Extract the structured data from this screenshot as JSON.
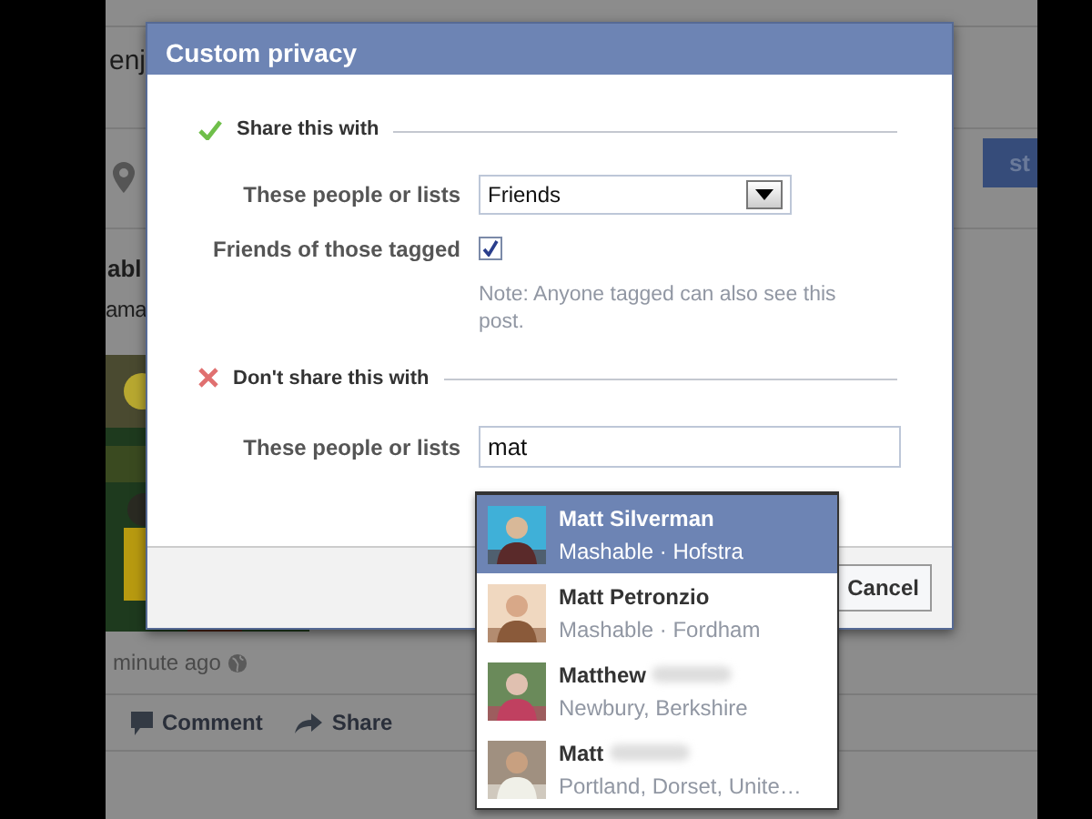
{
  "background_post": {
    "text_1": "enj",
    "button": "st",
    "title": "abl",
    "text_2": "ama",
    "time": "minute ago",
    "actions": [
      {
        "kind": "comment",
        "label": "Comment"
      },
      {
        "kind": "share",
        "label": "Share"
      }
    ]
  },
  "dialog": {
    "title": "Custom privacy",
    "share_section": {
      "heading": "Share this with",
      "field_label": "These people or lists",
      "select_value": "Friends",
      "tagged_label": "Friends of those tagged",
      "tagged_checked": true,
      "note": "Note: Anyone tagged can also see this post."
    },
    "exclude_section": {
      "heading": "Don't share this with",
      "field_label": "These people or lists",
      "input_value": "mat"
    },
    "buttons": [
      "Cancel"
    ]
  },
  "suggestions": [
    {
      "name": "Matt Silverman",
      "detail": "Mashable · Hofstra",
      "selected": true,
      "surname_hidden": false
    },
    {
      "name": "Matt Petronzio",
      "detail": "Mashable · Fordham",
      "selected": false,
      "surname_hidden": false
    },
    {
      "name": "Matthew",
      "detail": "Newbury, Berkshire",
      "selected": false,
      "surname_hidden": true
    },
    {
      "name": "Matt",
      "detail": "Portland, Dorset, Unite…",
      "selected": false,
      "surname_hidden": true
    }
  ]
}
